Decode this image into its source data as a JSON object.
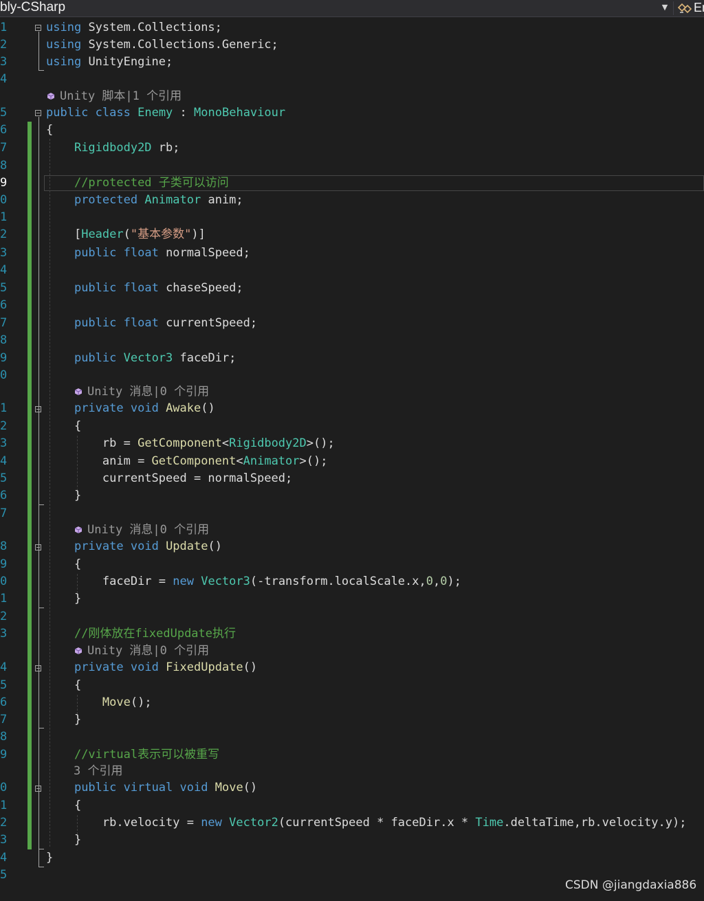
{
  "window": {
    "project_label": "bly-CSharp",
    "member_label": "En"
  },
  "editor": {
    "line_numbers": [
      "1",
      "2",
      "3",
      "4",
      "5",
      "6",
      "7",
      "8",
      "9",
      "0",
      "1",
      "2",
      "3",
      "4",
      "5",
      "6",
      "7",
      "8",
      "9",
      "0",
      "1",
      "2",
      "3",
      "4",
      "5",
      "6",
      "7",
      "8",
      "9",
      "0",
      "1",
      "2",
      "3",
      "4",
      "5",
      "6",
      "7",
      "8",
      "9",
      "0",
      "1",
      "2",
      "3",
      "4",
      "5"
    ],
    "code_lens": {
      "unity_script_1_ref": "Unity 脚本|1 个引用",
      "unity_message_0_ref": "Unity 消息|0 个引用",
      "refs_3": "3 个引用"
    },
    "code": {
      "using": "using",
      "ns_collections": "System.Collections;",
      "ns_generic": "System.Collections.Generic;",
      "ns_unity": "UnityEngine;",
      "public": "public",
      "class": "class",
      "class_name": "Enemy",
      "colon": ":",
      "base_class": "MonoBehaviour",
      "brace_open": "{",
      "brace_close": "}",
      "rigidbody2d": "Rigidbody2D",
      "rb_decl": "rb;",
      "comment_protected": "//protected 子类可以访问",
      "protected": "protected",
      "animator": "Animator",
      "anim_decl": "anim;",
      "attr_open": "[",
      "header": "Header",
      "header_arg_open": "(",
      "header_string": "\"基本参数\"",
      "attr_close": ")]",
      "float": "float",
      "normal_speed_decl": "normalSpeed;",
      "chase_speed_decl": "chaseSpeed;",
      "current_speed_decl": "currentSpeed;",
      "vector3": "Vector3",
      "facedir_decl": "faceDir;",
      "private": "private",
      "void": "void",
      "awake": "Awake",
      "parens": "()",
      "rb_assign": "rb = ",
      "get_component": "GetComponent",
      "lt": "<",
      "gt_call": ">();",
      "anim_assign": "anim = ",
      "current_speed_assign": "currentSpeed = normalSpeed;",
      "update": "Update",
      "facedir_assign": "faceDir = ",
      "new": "new",
      "vector3_args_a": "(-transform.localScale.x,",
      "zero": "0",
      "comma": ",",
      "close_semi": ");",
      "comment_fixed": "//刚体放在fixedUpdate执行",
      "fixed_update": "FixedUpdate",
      "move": "Move",
      "move_call_end": "();",
      "comment_virtual": "//virtual表示可以被重写",
      "virtual": "virtual",
      "rb_velocity_assign": "rb.velocity = ",
      "vector2": "Vector2",
      "v2_args_a": "(currentSpeed * faceDir.x * ",
      "time": "Time",
      "v2_args_b": ".deltaTime,rb.velocity.y);"
    }
  },
  "watermark": "CSDN @jiangdaxia886",
  "colors": {
    "background": "#1e1e1e",
    "keyword": "#569cd6",
    "type": "#4ec9b0",
    "method": "#dcdcaa",
    "comment": "#57a64a",
    "string": "#d69d85",
    "number": "#b5cea8",
    "line_number": "#2b91af",
    "change_bar": "#57a64a"
  }
}
